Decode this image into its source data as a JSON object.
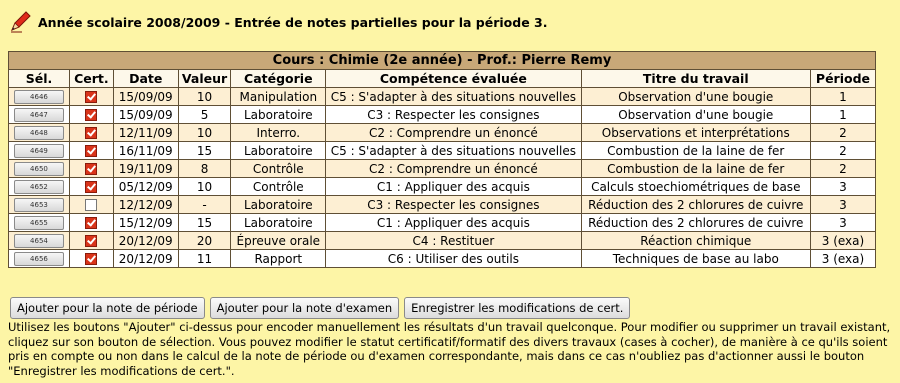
{
  "header": {
    "title": "Année scolaire 2008/2009 - Entrée de notes partielles pour la période 3."
  },
  "course": {
    "title": "Cours : Chimie (2e année) - Prof.: Pierre Remy"
  },
  "columns": [
    "Sél.",
    "Cert.",
    "Date",
    "Valeur",
    "Catégorie",
    "Compétence évaluée",
    "Titre du travail",
    "Période"
  ],
  "rows": [
    {
      "id": "4646",
      "cert": true,
      "date": "15/09/09",
      "valeur": "10",
      "categorie": "Manipulation",
      "competence": "C5 : S'adapter à des situations nouvelles",
      "titre": "Observation d'une bougie",
      "periode": "1"
    },
    {
      "id": "4647",
      "cert": true,
      "date": "15/09/09",
      "valeur": "5",
      "categorie": "Laboratoire",
      "competence": "C3 : Respecter les consignes",
      "titre": "Observation d'une bougie",
      "periode": "1"
    },
    {
      "id": "4648",
      "cert": true,
      "date": "12/11/09",
      "valeur": "10",
      "categorie": "Interro.",
      "competence": "C2 : Comprendre un énoncé",
      "titre": "Observations et interprétations",
      "periode": "2"
    },
    {
      "id": "4649",
      "cert": true,
      "date": "16/11/09",
      "valeur": "15",
      "categorie": "Laboratoire",
      "competence": "C5 : S'adapter à des situations nouvelles",
      "titre": "Combustion de la laine de fer",
      "periode": "2"
    },
    {
      "id": "4650",
      "cert": true,
      "date": "19/11/09",
      "valeur": "8",
      "categorie": "Contrôle",
      "competence": "C2 : Comprendre un énoncé",
      "titre": "Combustion de la laine de fer",
      "periode": "2"
    },
    {
      "id": "4652",
      "cert": true,
      "date": "05/12/09",
      "valeur": "10",
      "categorie": "Contrôle",
      "competence": "C1 : Appliquer des acquis",
      "titre": "Calculs stoechiométriques de base",
      "periode": "3"
    },
    {
      "id": "4653",
      "cert": false,
      "date": "12/12/09",
      "valeur": "-",
      "categorie": "Laboratoire",
      "competence": "C3 : Respecter les consignes",
      "titre": "Réduction des 2 chlorures de cuivre",
      "periode": "3"
    },
    {
      "id": "4655",
      "cert": true,
      "date": "15/12/09",
      "valeur": "15",
      "categorie": "Laboratoire",
      "competence": "C1 : Appliquer des acquis",
      "titre": "Réduction des 2 chlorures de cuivre",
      "periode": "3"
    },
    {
      "id": "4654",
      "cert": true,
      "date": "20/12/09",
      "valeur": "20",
      "categorie": "Épreuve orale",
      "competence": "C4 : Restituer",
      "titre": "Réaction chimique",
      "periode": "3 (exa)"
    },
    {
      "id": "4656",
      "cert": true,
      "date": "20/12/09",
      "valeur": "11",
      "categorie": "Rapport",
      "competence": "C6 : Utiliser des outils",
      "titre": "Techniques de base au labo",
      "periode": "3 (exa)"
    }
  ],
  "actions": {
    "add_period": "Ajouter pour la note de période",
    "add_exam": "Ajouter pour la note d'examen",
    "save_cert": "Enregistrer les modifications de cert."
  },
  "help_text": "Utilisez les boutons \"Ajouter\" ci-dessus pour encoder manuellement les résultats d'un travail quelconque. Pour modifier ou supprimer un travail existant, cliquez sur son bouton de sélection. Vous pouvez modifier le statut certificatif/formatif des divers travaux (cases à cocher), de manière à ce qu'ils soient pris en compte ou non dans le calcul de la note de période ou d'examen correspondante, mais dans ce cas n'oubliez pas d'actionner aussi le bouton \"Enregistrer les modifications de cert.\".",
  "colors": {
    "background": "#fdf5a6",
    "table_header": "#c8a878",
    "row_odd": "#fdefd3",
    "row_even": "#ffffff",
    "checkbox_checked": "#d9341a"
  },
  "icons": {
    "header": "pencil-icon"
  }
}
